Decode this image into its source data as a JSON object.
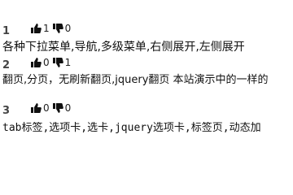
{
  "items": [
    {
      "index": "1",
      "likes": "1",
      "dislikes": "0",
      "text": "各种下拉菜单,导航,多级菜单,右侧展开,左侧展开"
    },
    {
      "index": "2",
      "likes": "0",
      "dislikes": "1",
      "text": "翻页,分页，无刷新翻页,jquery翻页 本站演示中的一样的"
    },
    {
      "index": "3",
      "likes": "0",
      "dislikes": "0",
      "text": "tab标签,选项卡,选卡,jquery选项卡,标签页,动态加"
    }
  ],
  "icons": {
    "like": "thumbs-up-icon",
    "dislike": "thumbs-down-icon"
  },
  "colors": {
    "icon": "#111111",
    "index": "#444444",
    "text": "#111111"
  }
}
